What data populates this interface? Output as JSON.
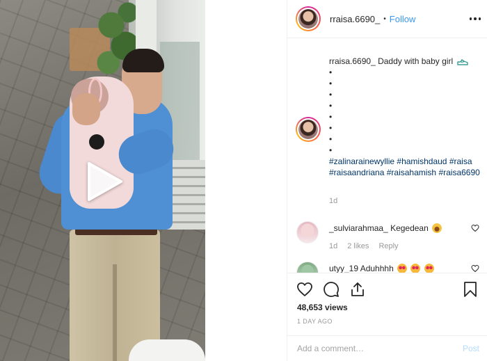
{
  "post": {
    "username": "rraisa.6690_",
    "header_separator": "•",
    "follow_label": "Follow",
    "caption": {
      "username": "rraisa.6690_",
      "text": "Daddy with baby girl",
      "emoji_icon": "running-shoe-icon",
      "bullets": [
        "•",
        "•",
        "•",
        "•",
        "•",
        "•",
        "•",
        "•"
      ],
      "hashtags": [
        "#zalinarainewyllie",
        "#hamishdaud",
        "#raisa",
        "#raisaandriana",
        "#raisahamish",
        "#raisa6690"
      ],
      "time": "1d"
    },
    "comments": [
      {
        "username": "_sulviarahmaa_",
        "text": "Kegedean",
        "emojis": [
          "laugh"
        ],
        "time": "1d",
        "likes": "2 likes",
        "reply": "Reply"
      },
      {
        "username": "utyy_19",
        "text": "Aduhhhh",
        "emojis": [
          "love",
          "love",
          "love"
        ],
        "time": "",
        "likes": "",
        "reply": ""
      }
    ],
    "views": "48,653 views",
    "time_ago": "1 DAY AGO",
    "comment_placeholder": "Add a comment…",
    "post_label": "Post"
  },
  "colors": {
    "follow": "#3897f0",
    "hashtag": "#003569",
    "muted": "#999999",
    "post_disabled": "#b3dbff"
  },
  "icons": [
    "play-icon",
    "more-icon",
    "heart-icon",
    "comment-icon",
    "share-icon",
    "bookmark-icon"
  ]
}
